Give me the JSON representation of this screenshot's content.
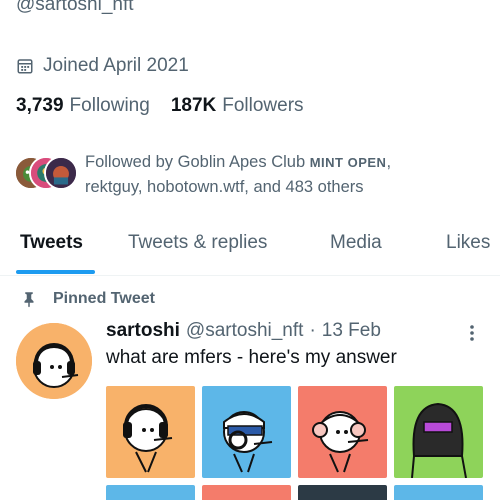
{
  "profile": {
    "handle": "@sartoshi_nft",
    "joined": "Joined April 2021",
    "following_count": "3,739",
    "following_label": "Following",
    "followers_count": "187K",
    "followers_label": "Followers",
    "followed_by_prefix": "Followed by Goblin Apes Club ",
    "followed_by_smallcaps": "MINT OPEN",
    "followed_by_rest": ",",
    "followed_by_line2": "rektguy, hobotown.wtf, and 483 others"
  },
  "tabs": [
    {
      "label": "Tweets",
      "active": true
    },
    {
      "label": "Tweets & replies",
      "active": false
    },
    {
      "label": "Media",
      "active": false
    },
    {
      "label": "Likes",
      "active": false
    }
  ],
  "pinned_label": "Pinned Tweet",
  "tweet": {
    "name": "sartoshi",
    "handle": "@sartoshi_nft",
    "separator": "·",
    "date": "13 Feb",
    "text": "what are mfers - here's my answer"
  },
  "colors": {
    "accent": "#1d9bf0",
    "text_primary": "#0f1419",
    "text_secondary": "#536471",
    "grid_backgrounds": [
      "#f8b26a",
      "#5db7e8",
      "#f47c6b",
      "#8ed35a",
      "#5db7e8",
      "#f47c6b",
      "#2c3a45",
      "#5db7e8"
    ]
  },
  "icons": {
    "joined": "calendar-icon",
    "pinned": "pin-icon",
    "more": "more-icon"
  }
}
